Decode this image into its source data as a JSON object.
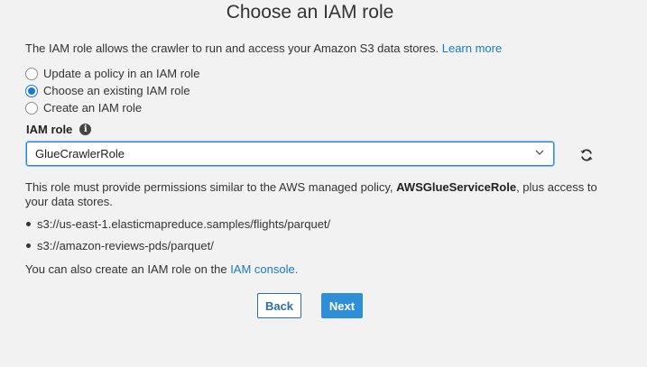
{
  "page": {
    "title": "Choose an IAM role",
    "intro_text": "The IAM role allows the crawler to run and access your Amazon S3 data stores.",
    "learn_more": "Learn more"
  },
  "radio_options": [
    {
      "label": "Update a policy in an IAM role",
      "checked": false
    },
    {
      "label": "Choose an existing IAM role",
      "checked": true
    },
    {
      "label": "Create an IAM role",
      "checked": false
    }
  ],
  "iam_role": {
    "label": "IAM role",
    "info_icon": "info-icon",
    "selected_value": "GlueCrawlerRole",
    "refresh_icon": "refresh-icon"
  },
  "description": {
    "prefix": "This role must provide permissions similar to the AWS managed policy,",
    "policy": "AWSGlueServiceRole",
    "suffix": ", plus access to your data stores."
  },
  "data_stores": [
    "s3://us-east-1.elasticmapreduce.samples/flights/parquet/",
    "s3://amazon-reviews-pds/parquet/"
  ],
  "console": {
    "text": "You can also create an IAM role on the",
    "link": "IAM console."
  },
  "buttons": {
    "back": "Back",
    "next": "Next"
  },
  "colors": {
    "accent": "#2f8ed8",
    "link": "#1a7ac2",
    "background": "#f2f2f2"
  }
}
